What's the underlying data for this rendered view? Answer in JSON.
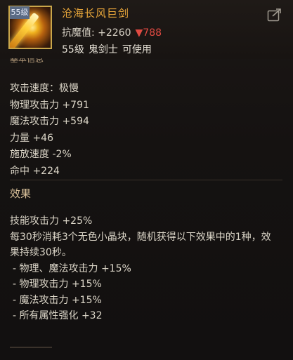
{
  "item": {
    "name": "沧海长风巨剑",
    "level_badge": "55级",
    "icon": "golden-greatsword-icon",
    "resist_label": "抗魔值: +2260",
    "resist_change": "▼788",
    "requirement": {
      "level": "55级",
      "class": "鬼剑士",
      "status": "可使用"
    }
  },
  "share_icon": "share-export-icon",
  "section_label_partial": "基本信息",
  "stats": [
    "攻击速度：极慢",
    "物理攻击力 +791",
    "魔法攻击力 +594",
    "力量 +46",
    "施放速度 -2%",
    "命中 +224"
  ],
  "effects": {
    "title": "效果",
    "lines": [
      "技能攻击力 +25%",
      "每30秒消耗3个无色小晶块，随机获得以下效果中的1种，效果持续30秒。"
    ],
    "sub_lines": [
      "- 物理、魔法攻击力 +15%",
      "- 物理攻击力 +15%",
      "- 魔法攻击力 +15%",
      "- 所有属性强化 +32"
    ]
  },
  "colors": {
    "name": "#e8a63a",
    "resist_down": "#e04a42",
    "background": "#141110"
  }
}
